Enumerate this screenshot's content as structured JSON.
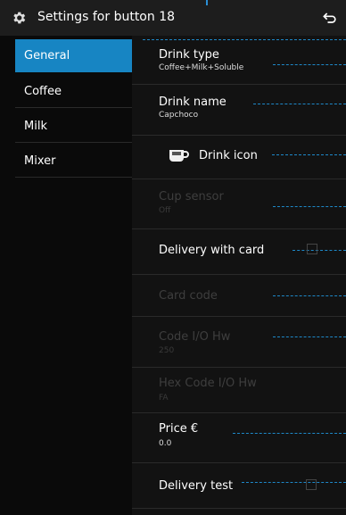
{
  "header": {
    "title": "Settings for button 18"
  },
  "sidebar": {
    "items": [
      {
        "label": "General",
        "active": true
      },
      {
        "label": "Coffee"
      },
      {
        "label": "Milk"
      },
      {
        "label": "Mixer"
      }
    ]
  },
  "settings": [
    {
      "id": "drink-type",
      "title": "Drink type",
      "value": "Coffee+Milk+Soluble",
      "enabled": true
    },
    {
      "id": "drink-name",
      "title": "Drink name",
      "value": "Capchoco",
      "enabled": true
    },
    {
      "id": "drink-icon",
      "title": "Drink icon",
      "icon": "coffee-cup-icon",
      "enabled": true
    },
    {
      "id": "cup-sensor",
      "title": "Cup sensor",
      "value": "Off",
      "enabled": false
    },
    {
      "id": "delivery-with-card",
      "title": "Delivery with card",
      "checked": false,
      "enabled": true
    },
    {
      "id": "card-code",
      "title": "Card code",
      "enabled": false
    },
    {
      "id": "code-io-hw",
      "title": "Code I/O Hw",
      "value": "250",
      "enabled": false
    },
    {
      "id": "hex-code-io-hw",
      "title": "Hex Code I/O Hw",
      "value": "FA",
      "enabled": false
    },
    {
      "id": "price",
      "title": "Price €",
      "value": "0.0",
      "enabled": true
    },
    {
      "id": "delivery-test",
      "title": "Delivery test",
      "checked": false,
      "enabled": true
    }
  ],
  "colors": {
    "accent": "#1785c3",
    "dashed_line": "#1e88c8",
    "background": "#000000"
  }
}
